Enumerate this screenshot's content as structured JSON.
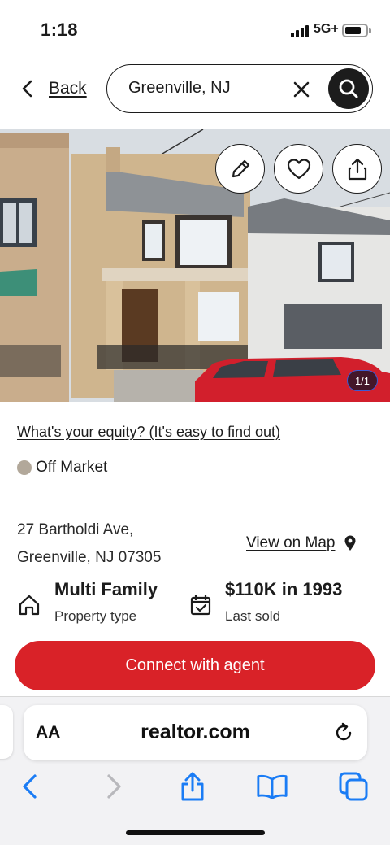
{
  "status_bar": {
    "time": "1:18",
    "network": "5G+"
  },
  "header": {
    "back_label": "Back",
    "search_value": "Greenville, NJ",
    "icons": {
      "back": "chevron-left-icon",
      "clear": "close-icon",
      "search": "search-icon"
    }
  },
  "photo": {
    "counter": "1/1",
    "actions": [
      "pencil-icon",
      "heart-icon",
      "share-icon"
    ]
  },
  "listing": {
    "equity_link": "What's your equity? (It's easy to find out)",
    "status": "Off Market",
    "status_color": "#b2a89a",
    "address_line1": "27 Bartholdi Ave,",
    "address_line2": "Greenville, NJ 07305",
    "map_link": "View on Map",
    "facts": [
      {
        "value": "Multi Family",
        "label": "Property type",
        "icon": "house-icon"
      },
      {
        "value": "$110K in 1993",
        "label": "Last sold",
        "icon": "calendar-check-icon"
      }
    ]
  },
  "cta": {
    "label": "Connect with agent",
    "color": "#d92228"
  },
  "browser": {
    "text_size_label": "AA",
    "url": "realtor.com",
    "accent": "#1a7cf5"
  }
}
